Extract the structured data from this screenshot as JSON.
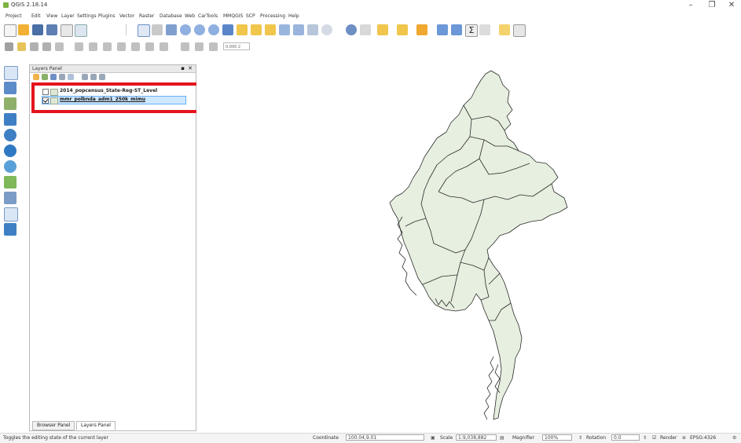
{
  "window": {
    "title": "QGIS 2.18.14",
    "controls": [
      "–",
      "❐",
      "✕"
    ]
  },
  "menu": [
    "Project",
    "Edit",
    "View",
    "Layer",
    "Settings",
    "Plugins",
    "Vector",
    "Raster",
    "Database",
    "Web",
    "CarTools",
    "MMQGIS",
    "SCP",
    "Processing",
    "Help"
  ],
  "toolbar": {
    "scale_value": "0.000 2"
  },
  "layers_panel": {
    "title": "Layers Panel",
    "close_icon": "✕",
    "float_icon": "▪",
    "layers": [
      {
        "name": "2014_popcensus_State-Reg-ST_Level",
        "checked": false,
        "selected": false
      },
      {
        "name": "mmr_polbnda_adm1_250k_mimu",
        "checked": true,
        "selected": true
      }
    ],
    "tabs": [
      "Browser Panel",
      "Layers Panel"
    ]
  },
  "map": {
    "fill_color": "#e6efe0",
    "stroke_color": "#2b2b2b"
  },
  "status": {
    "message": "Toggles the editing state of the current layer",
    "coordinate_label": "Coordinate",
    "coordinate_value": "100.04,9.01",
    "scale_label": "Scale",
    "scale_value": "1:9,038,882",
    "magnifier_label": "Magnifier",
    "magnifier_value": "100%",
    "rotation_label": "Rotation",
    "rotation_value": "0.0",
    "render_label": "Render",
    "crs_label": "EPSG:4326"
  },
  "colors": {
    "highlight_box": "#e4141e",
    "selection": "#cde8ff"
  }
}
